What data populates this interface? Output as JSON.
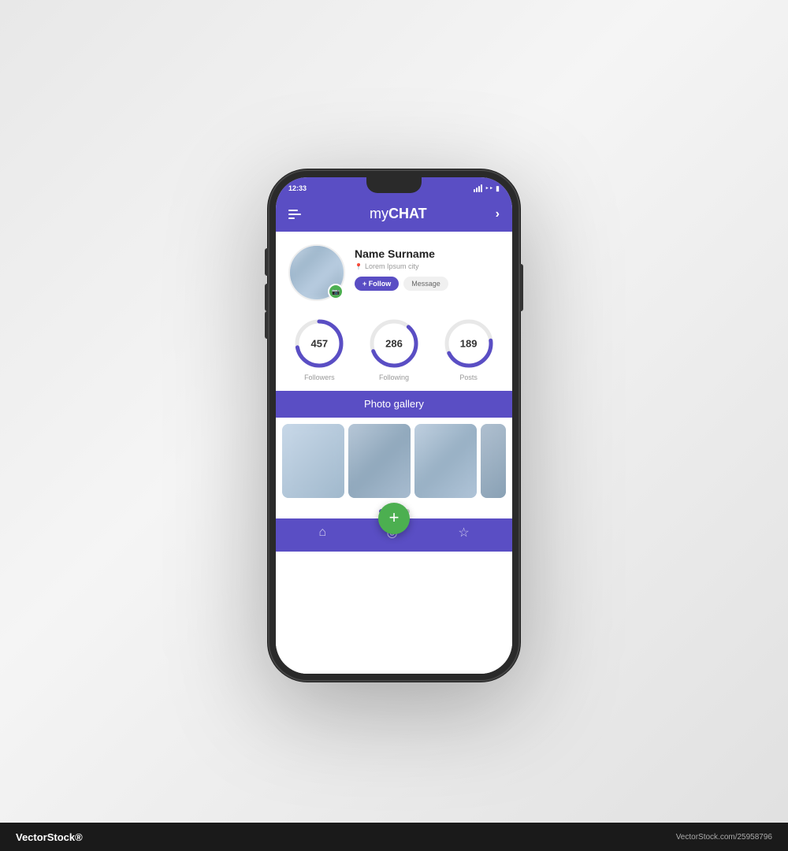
{
  "status_bar": {
    "time": "12:33",
    "battery": "🔋",
    "wifi": "📶"
  },
  "header": {
    "title_prefix": "my",
    "title_main": "CHAT",
    "chevron": "›"
  },
  "profile": {
    "name": "Name Surname",
    "city": "Lorem Ipsum city",
    "follow_label": "+ Follow",
    "message_label": "Message"
  },
  "stats": [
    {
      "value": "457",
      "label": "Followers",
      "pct": 72
    },
    {
      "value": "286",
      "label": "Following",
      "pct": 58
    },
    {
      "value": "189",
      "label": "Posts",
      "pct": 45
    }
  ],
  "gallery": {
    "title": "Photo gallery",
    "dots": [
      true,
      false,
      false,
      false
    ]
  },
  "fab": {
    "label": "+"
  },
  "watermark": {
    "left": "VectorStock®",
    "right": "VectorStock.com/25958796"
  }
}
